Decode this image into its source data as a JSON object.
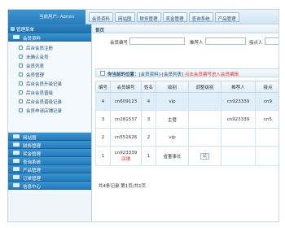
{
  "header": {
    "current_user": "当前用户: Admin",
    "tabs": [
      "会员资料",
      "网站图",
      "财务管理",
      "奖金管理",
      "查询系统",
      "产品管理"
    ]
  },
  "sidebar": {
    "title": "管理菜单",
    "groups_top": [
      {
        "label": "会员资料",
        "items": [
          "后台会员注册",
          "未确认会员",
          "会员列表",
          "会员管理",
          "后台会员升级记录",
          "后台会员晋级",
          "后台会员晋级记录",
          "会员申请店铺记录"
        ]
      }
    ],
    "groups_bottom": [
      "网站图",
      "财务管理",
      "奖金管理",
      "查询系统",
      "产品管理",
      "订单管理",
      "信息中心"
    ]
  },
  "main": {
    "breadcrumb": "首页",
    "search": {
      "member_no_label": "会员编号",
      "referrer_label": "推荐人",
      "node_label": "接点人"
    },
    "info": {
      "position_label": "你当前的位置",
      "location": "[会员资料]-[会员列表]",
      "hint": "点击会员编号进入会员编辑"
    },
    "table": {
      "headers": [
        "编号",
        "会员编号",
        "姓名",
        "级别",
        "调整级别",
        "推荐人",
        "接点"
      ],
      "rows": [
        {
          "no": "4",
          "member_no": "cn609123",
          "member_no_extra": "",
          "name": "4",
          "level": "vip",
          "adjust": "",
          "referrer": "cn923339",
          "node": "cn9"
        },
        {
          "no": "3",
          "member_no": "cn281537",
          "member_no_extra": "",
          "name": "3",
          "level": "主管",
          "adjust": "",
          "referrer": "cn923339",
          "node": "cn5"
        },
        {
          "no": "2",
          "member_no": "cn551626",
          "member_no_extra": "",
          "name": "2",
          "level": "vip",
          "adjust": "",
          "referrer": "",
          "node": ""
        },
        {
          "no": "1",
          "member_no": "cn923339",
          "member_no_extra": "店铺",
          "name": "1",
          "level": "省董事长",
          "adjust": "公",
          "referrer": "",
          "node": ""
        }
      ]
    },
    "pager": "共4条记录 第1页/共1页"
  }
}
